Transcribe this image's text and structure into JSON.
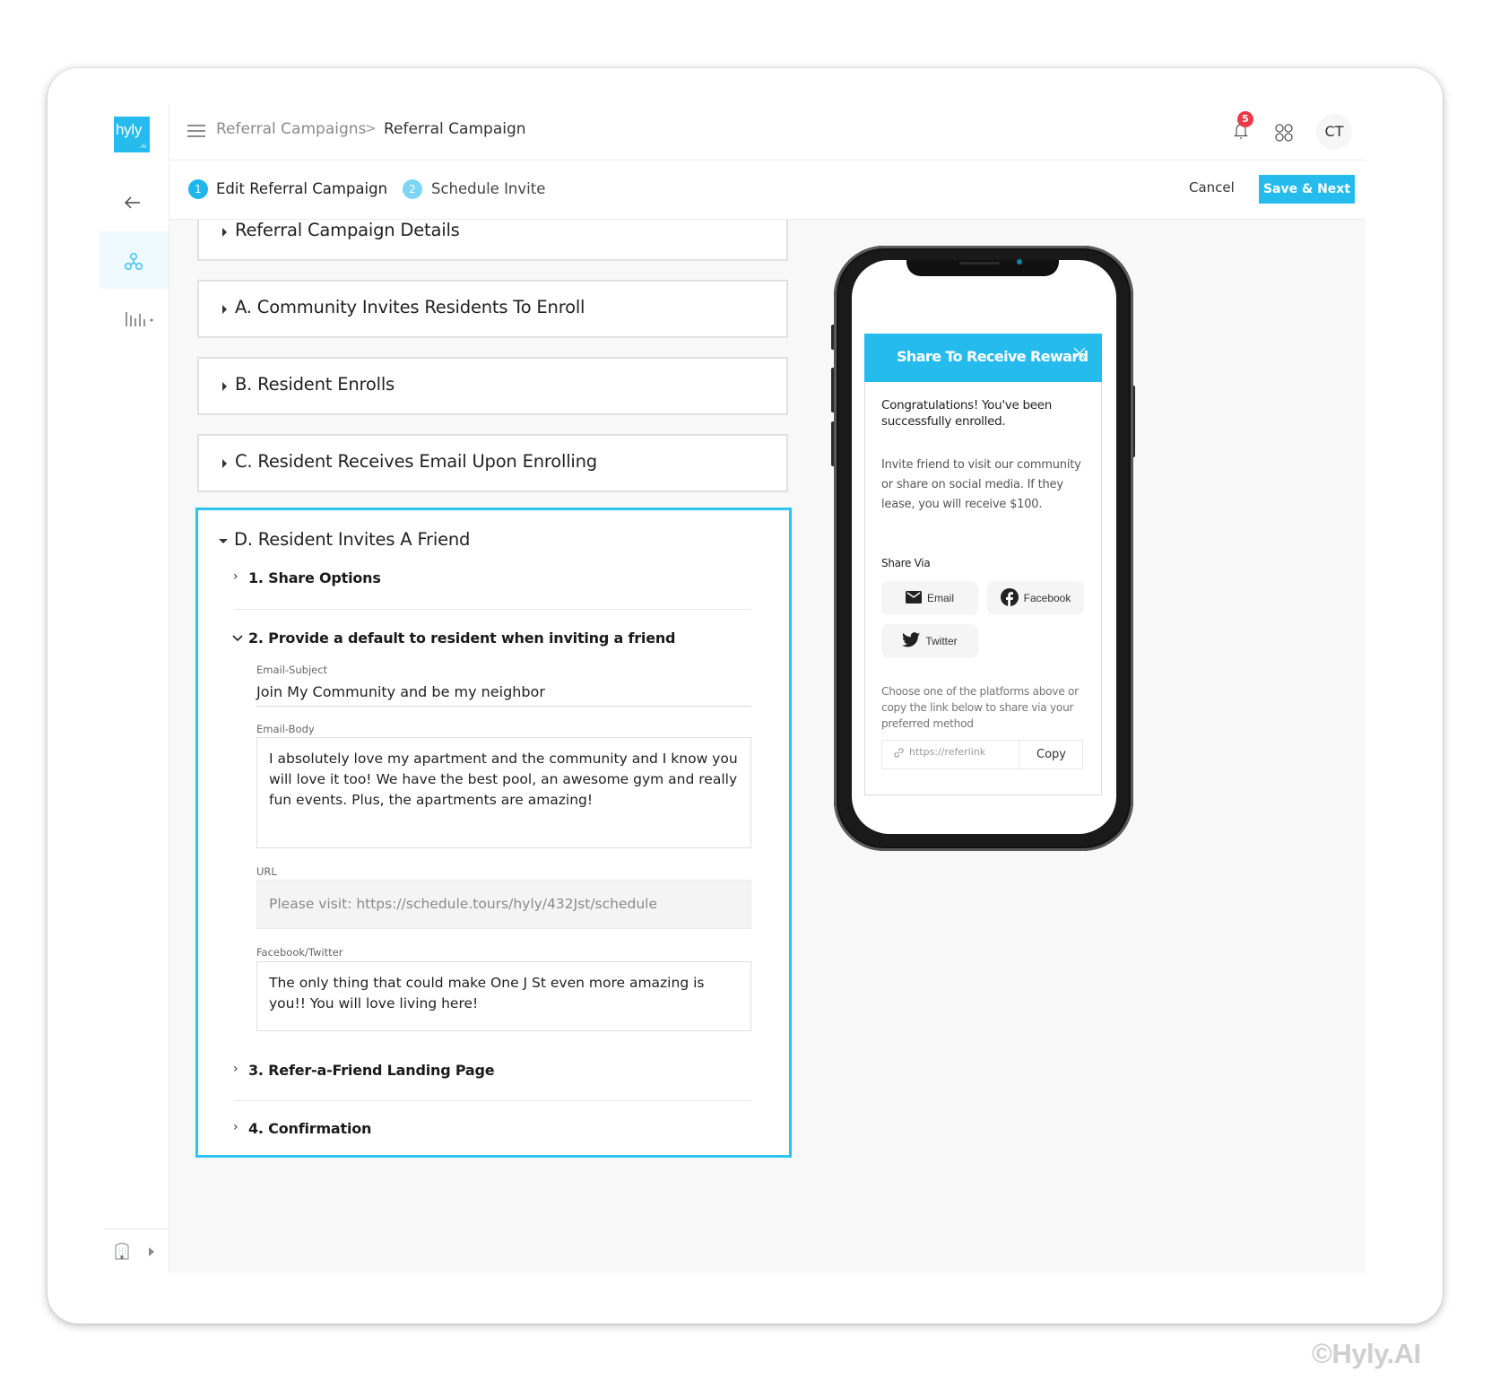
{
  "brand": {
    "logo_text": "hyly",
    "logo_suffix": ".AI",
    "accent": "#26bbed"
  },
  "breadcrumb": {
    "parent": "Referral Campaigns",
    "separator": ">",
    "current": "Referral Campaign"
  },
  "header": {
    "notification_count": "5",
    "avatar_initials": "CT"
  },
  "steps": [
    {
      "number": "1",
      "label": "Edit Referral Campaign",
      "active": true
    },
    {
      "number": "2",
      "label": "Schedule Invite",
      "active": false
    }
  ],
  "actions": {
    "cancel": "Cancel",
    "save_next": "Save & Next"
  },
  "sections": [
    {
      "title": "Referral Campaign Details",
      "expanded": false
    },
    {
      "title": "A. Community Invites Residents To Enroll",
      "expanded": false
    },
    {
      "title": "B. Resident Enrolls",
      "expanded": false
    },
    {
      "title": "C. Resident Receives Email Upon Enrolling",
      "expanded": false
    },
    {
      "title": "D. Resident Invites A Friend",
      "expanded": true
    }
  ],
  "section_d": {
    "subsections": [
      {
        "title": "1. Share Options",
        "expanded": false
      },
      {
        "title": "2. Provide a default to resident when inviting a friend",
        "expanded": true
      },
      {
        "title": "3. Refer-a-Friend Landing Page",
        "expanded": false
      },
      {
        "title": "4. Confirmation",
        "expanded": false
      }
    ],
    "fields": {
      "email_subject_label": "Email-Subject",
      "email_subject_value": "Join My Community and be my neighbor",
      "email_body_label": "Email-Body",
      "email_body_value": "I absolutely love my apartment and the community and I know you will love it too! We have the best pool, an awesome gym and really fun events. Plus, the apartments are amazing!",
      "url_label": "URL",
      "url_value": "Please visit: https://schedule.tours/hyly/432Jst/schedule",
      "social_label": "Facebook/Twitter",
      "social_value": "The only thing that could make One J St even more amazing is you!! You will love living here!"
    }
  },
  "preview": {
    "title": "Share To Receive Reward",
    "congrats": "Congratulations! You've been successfully enrolled.",
    "body": "Invite friend to visit our community or share on social media. If they lease, you will receive $100.",
    "share_via_label": "Share Via",
    "share_buttons": [
      {
        "label": "Email",
        "icon": "email-icon"
      },
      {
        "label": "Facebook",
        "icon": "facebook-icon"
      },
      {
        "label": "Twitter",
        "icon": "twitter-icon"
      }
    ],
    "hint": "Choose one of the platforms above or copy the link below to share via your preferred method",
    "link_placeholder": "https://referlink",
    "copy_label": "Copy"
  },
  "watermark": "©Hyly.AI"
}
